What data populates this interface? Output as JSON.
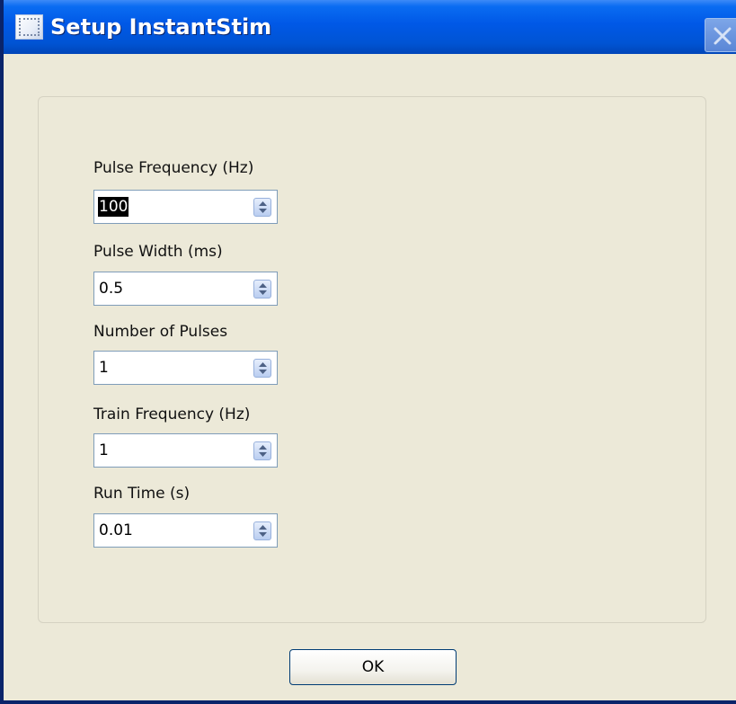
{
  "window": {
    "title": "Setup InstantStim",
    "icon": "app-window-icon",
    "close_icon": "close-icon"
  },
  "fields": [
    {
      "label": "Pulse Frequency (Hz)",
      "value": "100",
      "selected": true
    },
    {
      "label": "Pulse Width (ms)",
      "value": "0.5",
      "selected": false
    },
    {
      "label": "Number of Pulses",
      "value": "1",
      "selected": false
    },
    {
      "label": "Train Frequency (Hz)",
      "value": "1",
      "selected": false
    },
    {
      "label": "Run Time (s)",
      "value": "0.01",
      "selected": false
    }
  ],
  "buttons": {
    "ok_label": "OK"
  },
  "colors": {
    "titlebar": "#0058e6",
    "dialog_background": "#ece9d8",
    "spinbox_border": "#7f9db9"
  }
}
